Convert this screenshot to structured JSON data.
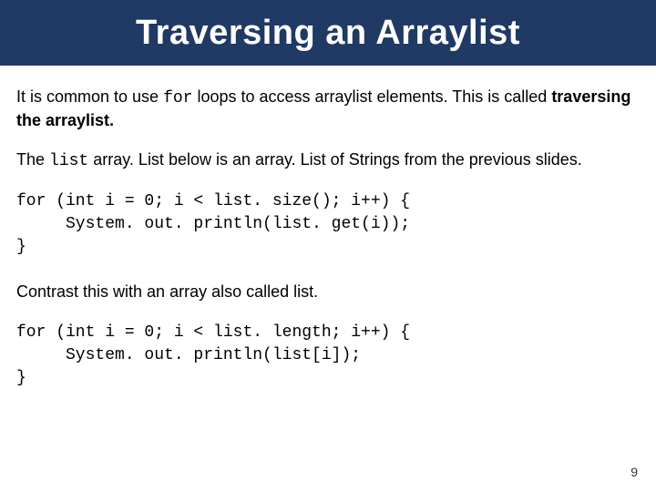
{
  "title": "Traversing an Arraylist",
  "p1": {
    "before_for": "It is common to use ",
    "for_kw": "for",
    "after_for": " loops to access arraylist elements. This is called ",
    "bold": "traversing the arraylist."
  },
  "p2": {
    "t1": "The ",
    "code1": "list",
    "t2": " array. List below is an array. List of Strings from the previous slides."
  },
  "code1": "for (int i = 0; i < list. size(); i++) {\n     System. out. println(list. get(i));\n}",
  "p3": "Contrast this with an array also called list.",
  "code2": "for (int i = 0; i < list. length; i++) {\n     System. out. println(list[i]);\n}",
  "page_number": "9"
}
